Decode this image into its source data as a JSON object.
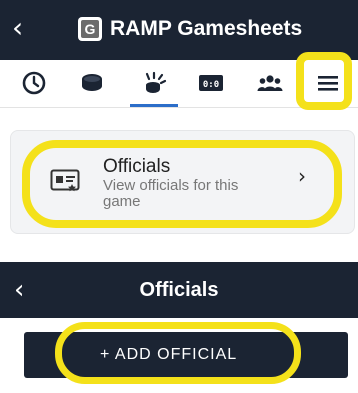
{
  "header": {
    "back_icon": "chevron-left-icon",
    "logo_letter": "G",
    "title": "RAMP Gamesheets"
  },
  "tabs": [
    {
      "icon": "clock-icon"
    },
    {
      "icon": "puck-icon"
    },
    {
      "icon": "goal-light-icon",
      "active": true
    },
    {
      "icon": "scoreboard-icon"
    },
    {
      "icon": "team-icon"
    },
    {
      "icon": "menu-icon",
      "highlighted": true
    }
  ],
  "officials_card": {
    "icon": "id-card-icon",
    "title": "Officials",
    "subtitle": "View officials for this game",
    "chevron": "›"
  },
  "officials_screen": {
    "back_icon": "chevron-left-icon",
    "title": "Officials",
    "add_button_label": "+  ADD OFFICIAL"
  },
  "colors": {
    "navy": "#1b2433",
    "highlight": "#f4e11a",
    "active_tab": "#2c6ec9",
    "card_bg": "#f3f4f6"
  }
}
